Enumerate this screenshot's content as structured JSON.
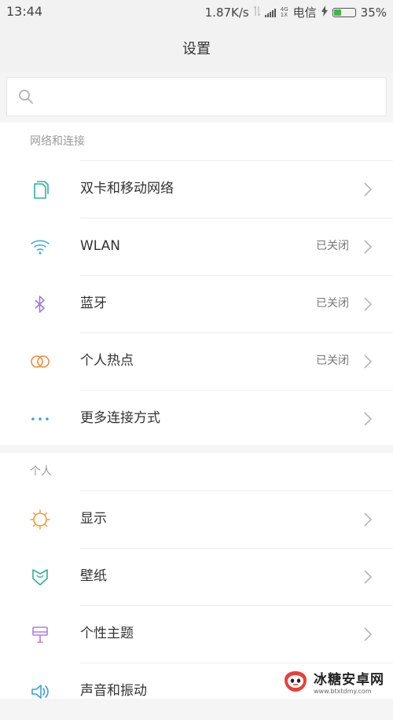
{
  "status_bar": {
    "time": "13:44",
    "speed": "1.87K/s",
    "network_top": "4G",
    "network_bottom": "1X",
    "carrier": "电信",
    "battery_percent": "35%",
    "battery_level": 0.35,
    "battery_color": "#43b649"
  },
  "header": {
    "title": "设置"
  },
  "search": {
    "placeholder": "",
    "value": ""
  },
  "sections": [
    {
      "title": "网络和连接",
      "items": [
        {
          "label": "双卡和移动网络",
          "status": "",
          "icon": "sim-card-icon",
          "icon_color": "#2bb39c"
        },
        {
          "label": "WLAN",
          "status": "已关闭",
          "icon": "wifi-icon",
          "icon_color": "#39a9e0"
        },
        {
          "label": "蓝牙",
          "status": "已关闭",
          "icon": "bluetooth-icon",
          "icon_color": "#9b7fd6"
        },
        {
          "label": "个人热点",
          "status": "已关闭",
          "icon": "hotspot-icon",
          "icon_color": "#f08a3c"
        },
        {
          "label": "更多连接方式",
          "status": "",
          "icon": "more-dots-icon",
          "icon_color": "#3a9fe2"
        }
      ]
    },
    {
      "title": "个人",
      "items": [
        {
          "label": "显示",
          "status": "",
          "icon": "sun-icon",
          "icon_color": "#f39a3c"
        },
        {
          "label": "壁纸",
          "status": "",
          "icon": "wallpaper-icon",
          "icon_color": "#2bb39c"
        },
        {
          "label": "个性主题",
          "status": "",
          "icon": "theme-brush-icon",
          "icon_color": "#b07fe0"
        },
        {
          "label": "声音和振动",
          "status": "",
          "icon": "speaker-icon",
          "icon_color": "#3a9fe2"
        }
      ]
    }
  ],
  "watermark": {
    "name": "冰糖安卓网",
    "url": "www.btxtdmy.com"
  }
}
